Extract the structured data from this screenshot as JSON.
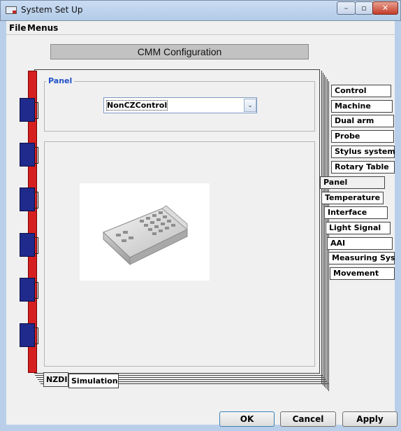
{
  "window": {
    "title": "System Set Up",
    "controls": {
      "minimize": "–",
      "maximize": "▫",
      "close": "✕"
    }
  },
  "menubar": {
    "items": [
      "File",
      "Menus"
    ]
  },
  "header": {
    "title": "CMM Configuration"
  },
  "panel": {
    "legend": "Panel",
    "select": {
      "value": "NonCZControl",
      "arrow": "⌄"
    }
  },
  "right_tabs": [
    {
      "label": "Control",
      "selected": false
    },
    {
      "label": "Machine",
      "selected": false
    },
    {
      "label": "Dual arm",
      "selected": false
    },
    {
      "label": "Probe",
      "selected": false
    },
    {
      "label": "Stylus system",
      "selected": false
    },
    {
      "label": "Rotary Table",
      "selected": false
    },
    {
      "label": "Panel",
      "selected": true
    },
    {
      "label": "Temperature",
      "selected": false
    },
    {
      "label": "Interface",
      "selected": false
    },
    {
      "label": "Light Signal",
      "selected": false
    },
    {
      "label": "AAI",
      "selected": false
    },
    {
      "label": "Measuring Sys",
      "selected": false
    },
    {
      "label": "Movement",
      "selected": false
    }
  ],
  "bottom_tabs": [
    {
      "label": "NZDI",
      "selected": true
    },
    {
      "label": "Simulation",
      "selected": false
    }
  ],
  "buttons": {
    "ok": "OK",
    "cancel": "Cancel",
    "apply": "Apply"
  },
  "colors": {
    "binder": "#d62020",
    "binder_tab": "#1f2a8c",
    "legend": "#2050c8"
  }
}
